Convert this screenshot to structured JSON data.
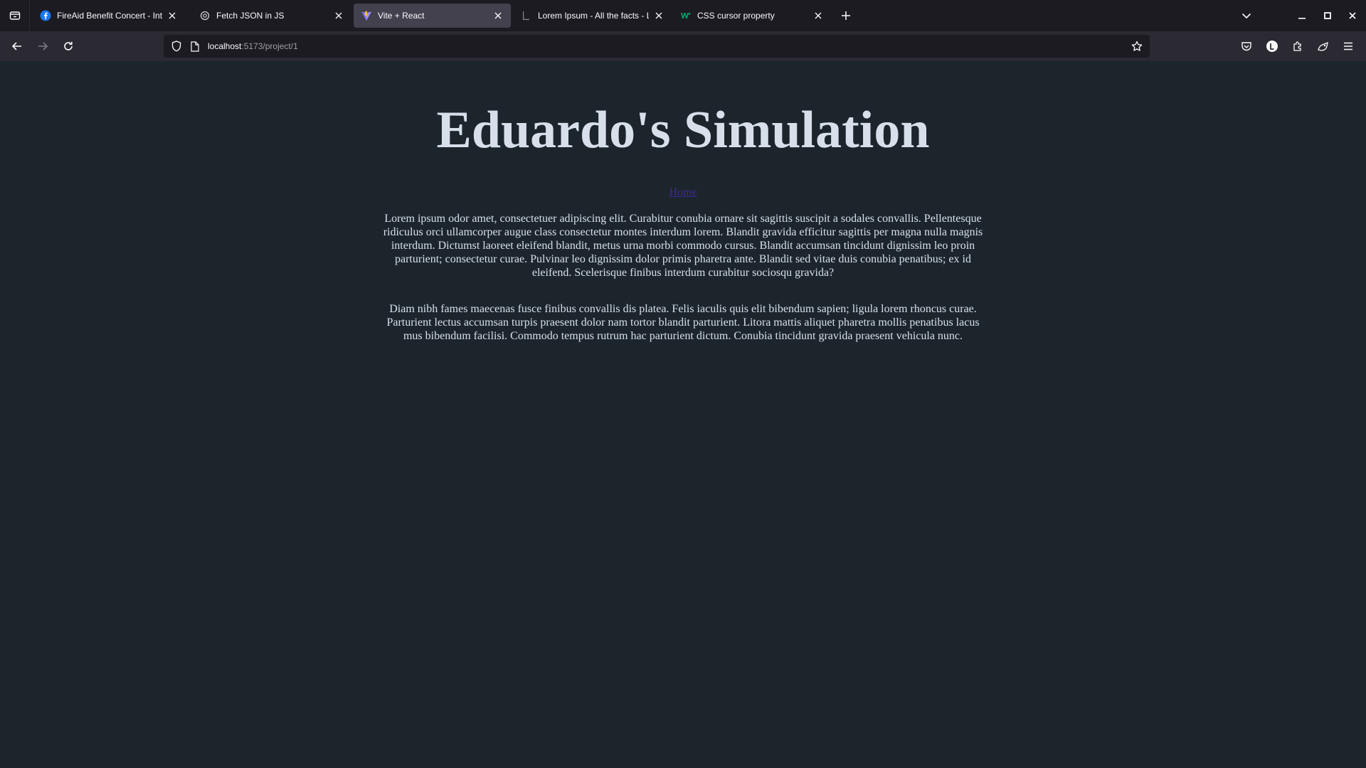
{
  "browser": {
    "tabs": [
      {
        "title": "FireAid Benefit Concert - Intuit Dome",
        "active": false,
        "icon": "facebook-icon"
      },
      {
        "title": "Fetch JSON in JS",
        "active": false,
        "icon": "openai-icon"
      },
      {
        "title": "Vite + React",
        "active": true,
        "icon": "vite-icon"
      },
      {
        "title": "Lorem Ipsum - All the facts - Lipsum generator",
        "active": false,
        "icon": "lipsum-icon"
      },
      {
        "title": "CSS cursor property",
        "active": false,
        "icon": "w3schools-icon"
      }
    ],
    "url": {
      "host": "localhost",
      "path": ":5173/project/1"
    },
    "colors": {
      "tabstrip": "#1c1b22",
      "toolbar": "#2b2a33",
      "active_tab": "#42414d",
      "page_background": "#1c252c"
    }
  },
  "page": {
    "title": "Eduardo's Simulation",
    "home_link": "Home",
    "paragraphs": [
      "Lorem ipsum odor amet, consectetuer adipiscing elit. Curabitur conubia ornare sit sagittis suscipit a sodales convallis. Pellentesque ridiculus orci ullamcorper augue class consectetur montes interdum lorem. Blandit gravida efficitur sagittis per magna nulla magnis interdum. Dictumst laoreet eleifend blandit, metus urna morbi commodo cursus. Blandit accumsan tincidunt dignissim leo proin parturient; consectetur curae. Pulvinar leo dignissim dolor primis pharetra ante. Blandit sed vitae duis conubia penatibus; ex id eleifend. Scelerisque finibus interdum curabitur sociosqu gravida?",
      "Diam nibh fames maecenas fusce finibus convallis dis platea. Felis iaculis quis elit bibendum sapien; ligula lorem rhoncus curae. Parturient lectus accumsan turpis praesent dolor nam tortor blandit parturient. Litora mattis aliquet pharetra mollis penatibus lacus mus bibendum facilisi. Commodo tempus rutrum hac parturient dictum. Conubia tincidunt gravida praesent vehicula nunc."
    ],
    "colors": {
      "text": "#d7e0ea",
      "link": "#3e2a8f"
    }
  }
}
